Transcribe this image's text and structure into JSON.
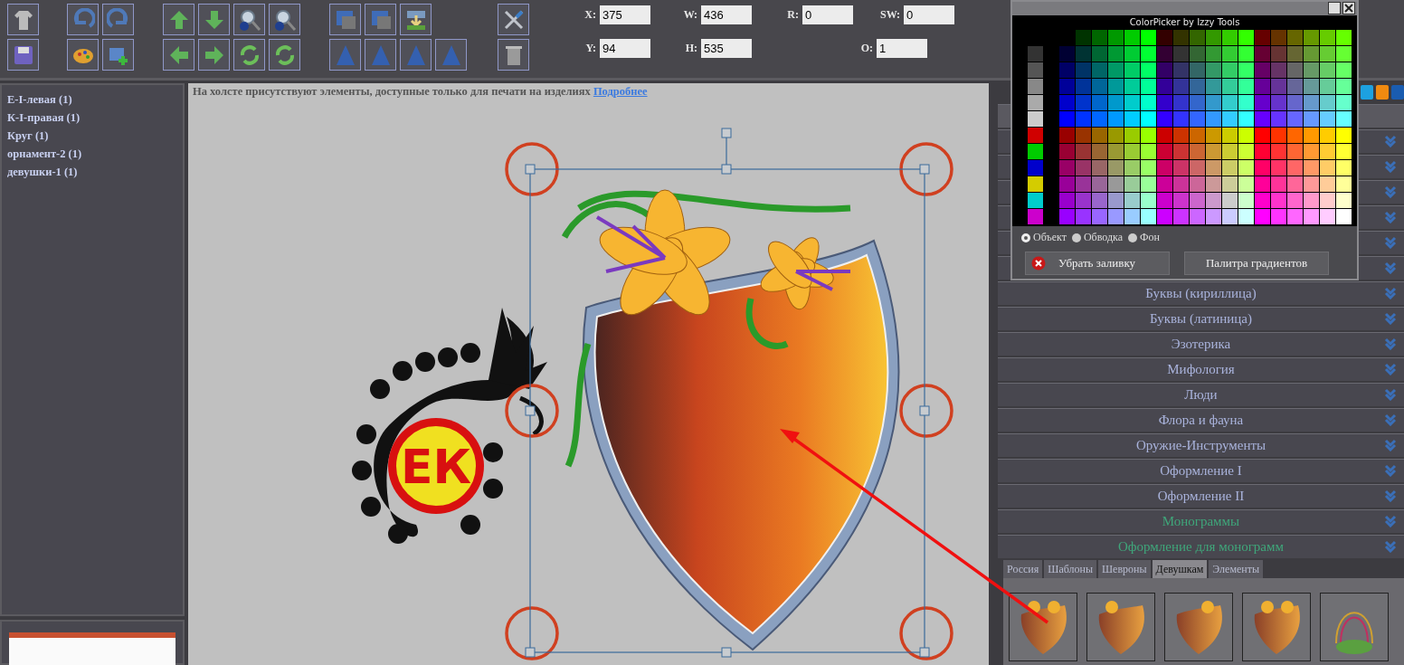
{
  "properties": {
    "fields": [
      {
        "label": "X:",
        "value": "375"
      },
      {
        "label": "W:",
        "value": "436"
      },
      {
        "label": "R:",
        "value": "0"
      },
      {
        "label": "SW:",
        "value": "0"
      },
      {
        "label": "Y:",
        "value": "94"
      },
      {
        "label": "H:",
        "value": "535"
      },
      {
        "label": "O:",
        "value": "1"
      }
    ]
  },
  "layers": [
    "Е-I-левая (1)",
    "К-I-правая (1)",
    "Круг (1)",
    "орнамент-2 (1)",
    "девушки-1 (1)"
  ],
  "canvas": {
    "notice": "На холсте присутствуют элементы, доступные только для печати на изделиях",
    "notice_link": "Подробнее",
    "monogram": "ЕК"
  },
  "color_picker": {
    "title": "ColorPicker by Izzy Tools",
    "targets": [
      {
        "label": "Объект",
        "selected": true
      },
      {
        "label": "Обводка",
        "selected": false
      },
      {
        "label": "Фон",
        "selected": false
      }
    ],
    "buttons": [
      "Убрать заливку",
      "Палитра градиентов"
    ]
  },
  "categories": [
    {
      "label": "Буквы (кириллица)",
      "color": "#a9b3dc"
    },
    {
      "label": "Буквы (латиница)",
      "color": "#a9b3dc"
    },
    {
      "label": "Эзотерика",
      "color": "#a9b3dc"
    },
    {
      "label": "Мифология",
      "color": "#a9b3dc"
    },
    {
      "label": "Люди",
      "color": "#a9b3dc"
    },
    {
      "label": "Флора и фауна",
      "color": "#a9b3dc"
    },
    {
      "label": "Оружие-Инструменты",
      "color": "#a9b3dc"
    },
    {
      "label": "Оформление I",
      "color": "#a9b3dc"
    },
    {
      "label": "Оформление II",
      "color": "#a9b3dc"
    },
    {
      "label": "Монограммы",
      "color": "#3fa67a"
    },
    {
      "label": "Оформление для монограмм",
      "color": "#3fa67a"
    }
  ],
  "tabs": [
    {
      "label": "Россия",
      "selected": false
    },
    {
      "label": "Шаблоны",
      "selected": false
    },
    {
      "label": "Шевроны",
      "selected": false
    },
    {
      "label": "Девушкам",
      "selected": true
    },
    {
      "label": "Элементы",
      "selected": false
    }
  ]
}
